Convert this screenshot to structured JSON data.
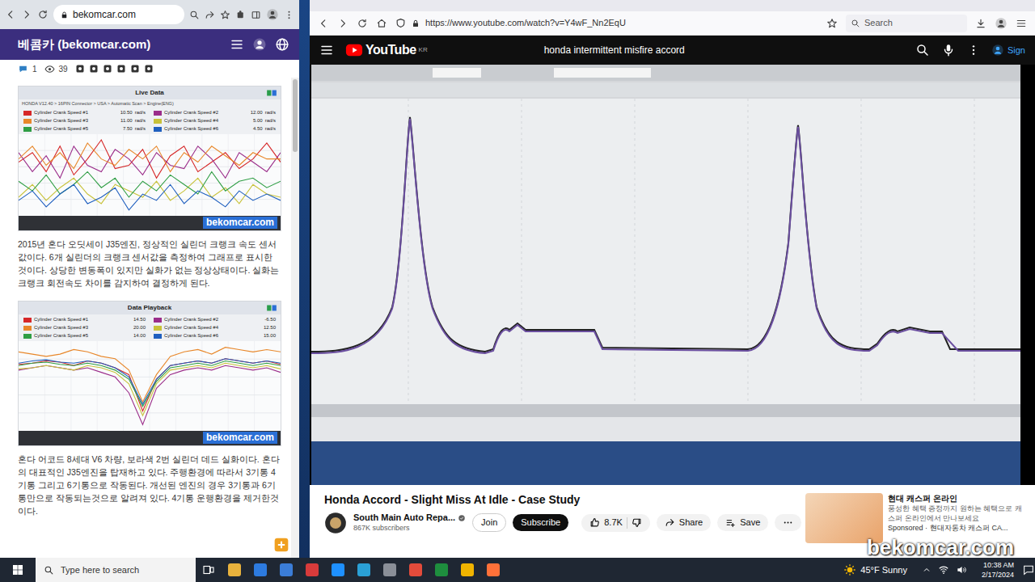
{
  "left_window": {
    "address": "bekomcar.com",
    "site_title": "베콤카 (bekomcar.com)",
    "comments": "1",
    "views": "39",
    "articles": [
      {
        "figure": {
          "title": "Live Data",
          "path": "HONDA V12.40 > 16PIN Connector > USA > Automatic Scan > Engine(ENG)",
          "watermark": "bekomcar.com",
          "series": [
            {
              "name": "Cylinder Crank Speed #1",
              "reading": "10.50",
              "unit": "rad/s",
              "color": "#d62728",
              "values": [
                10.5,
                12,
                9,
                13,
                8.5,
                11,
                14,
                9.5,
                10,
                12.5,
                8,
                11.5,
                13,
                9,
                10.5,
                12,
                9.5,
                11,
                13.5,
                10.5
              ]
            },
            {
              "name": "Cylinder Crank Speed #2",
              "reading": "12.00",
              "unit": "rad/s",
              "color": "#9b2d8a",
              "values": [
                12,
                9,
                11.5,
                8,
                13,
                10,
                9,
                12.5,
                11,
                8.5,
                12,
                10,
                9.5,
                13,
                11,
                8,
                12,
                10.5,
                9,
                12
              ]
            },
            {
              "name": "Cylinder Crank Speed #3",
              "reading": "11.00",
              "unit": "rad/s",
              "color": "#e8872a",
              "values": [
                11,
                13,
                10,
                12,
                9.5,
                13.5,
                11,
                10,
                12.5,
                11,
                13,
                9,
                12,
                10.5,
                13,
                11.5,
                10,
                12,
                11,
                11
              ]
            },
            {
              "name": "Cylinder Crank Speed #4",
              "reading": "5.00",
              "unit": "rad/s",
              "color": "#c8c23a",
              "values": [
                5,
                7,
                4.5,
                6.5,
                8,
                5.5,
                4,
                7,
                6,
                5,
                7.5,
                4.5,
                6,
                8,
                5,
                6.5,
                4,
                7,
                5.5,
                5
              ]
            },
            {
              "name": "Cylinder Crank Speed #5",
              "reading": "7.50",
              "unit": "rad/s",
              "color": "#2f9e44",
              "values": [
                7.5,
                6,
                8.5,
                5.5,
                7,
                9,
                6.5,
                8,
                5,
                7.5,
                6,
                8.5,
                7,
                5.5,
                9,
                6,
                7.5,
                8,
                6.5,
                7.5
              ]
            },
            {
              "name": "Cylinder Crank Speed #6",
              "reading": "4.50",
              "unit": "rad/s",
              "color": "#1f5fbf",
              "values": [
                4.5,
                6,
                3.5,
                5.5,
                7,
                4,
                5,
                6.5,
                3,
                5.5,
                4.5,
                7,
                4,
                6,
                5,
                3.5,
                6,
                4.5,
                5.5,
                4.5
              ]
            }
          ]
        },
        "text": "2015년 혼다 오딧세이 J35엔진, 정상적인 실린더 크랭크 속도 센서값이다. 6개 실린더의 크랭크 센서값을 측정하여 그래프로 표시한것이다. 상당한 변동폭이 있지만 실화가 없는 정상상태이다. 실화는 크랭크 회전속도 차이를 감지하여 결정하게 된다."
      },
      {
        "figure": {
          "title": "Data Playback",
          "watermark": "bekomcar.com",
          "series": [
            {
              "name": "Cylinder Crank Speed #1",
              "reading": "14.50",
              "color": "#d62728",
              "values": [
                14.5,
                15,
                16,
                15.5,
                14,
                16,
                15,
                13,
                10,
                -6,
                8,
                14,
                15,
                16,
                15,
                17,
                16,
                15,
                16,
                14.5
              ]
            },
            {
              "name": "Cylinder Crank Speed #2",
              "reading": "-6.50",
              "color": "#9b2d8a",
              "values": [
                12,
                13,
                14,
                13,
                12,
                13,
                11,
                9,
                2,
                -12,
                4,
                10,
                12,
                13,
                12,
                14,
                13,
                12,
                13,
                11
              ]
            },
            {
              "name": "Cylinder Crank Speed #3",
              "reading": "20.00",
              "color": "#e8872a",
              "values": [
                20,
                19,
                18,
                19,
                21,
                20,
                18,
                17,
                12,
                -2,
                10,
                18,
                20,
                21,
                19,
                22,
                21,
                20,
                21,
                20
              ]
            },
            {
              "name": "Cylinder Crank Speed #4",
              "reading": "12.50",
              "color": "#c8c23a",
              "values": [
                12.5,
                13,
                14,
                13,
                12,
                14,
                13,
                11,
                6,
                -8,
                6,
                12,
                13,
                14,
                13,
                15,
                14,
                13,
                14,
                12.5
              ]
            },
            {
              "name": "Cylinder Crank Speed #5",
              "reading": "14.00",
              "color": "#2f9e44",
              "values": [
                14,
                15,
                15.5,
                14.5,
                14,
                15,
                14,
                12,
                8,
                -4,
                7,
                13,
                14,
                15,
                14,
                16,
                15,
                14,
                15,
                14
              ]
            },
            {
              "name": "Cylinder Crank Speed #6",
              "reading": "15.00",
              "color": "#1f5fbf",
              "values": [
                15,
                16,
                16.5,
                15.5,
                15,
                16,
                15,
                13,
                9,
                -3,
                8,
                14,
                15,
                16,
                15,
                17,
                16,
                15,
                16,
                15
              ]
            }
          ]
        },
        "text": "혼다 어코드 8세대 V6 차량, 보라색 2번 실린더 데드 실화이다. 혼다의 대표적인 J35엔진을 탑재하고 있다. 주행환경에 따라서 3기통 4기통 그리고 6기통으로 작동된다. 개선된 엔진의 경우 3기통과 6기통만으로 작동되는것으로 알려져 있다. 4기통 운행환경을 제거한것이다."
      }
    ]
  },
  "right_window": {
    "address": "https://www.youtube.com/watch?v=Y4wF_Nn2EqU",
    "search_placeholder": "Search",
    "youtube": {
      "logo": "YouTube",
      "region": "KR",
      "query": "honda intermittent misfire accord",
      "sign_in": "Sign"
    },
    "video": {
      "title": "Honda Accord - Slight Miss At Idle - Case Study",
      "channel": "South Main Auto Repa...",
      "subscribers": "867K subscribers",
      "join": "Join",
      "subscribe": "Subscribe",
      "likes": "8.7K",
      "share": "Share",
      "save": "Save"
    },
    "ad": {
      "title": "현대 캐스퍼 온라인",
      "description": "풍성한 혜택 증정까지 원하는 혜택으로 캐스퍼 온라인에서 만나보세요",
      "sponsor": "Sponsored · 현대자동차 캐스퍼 CA..."
    }
  },
  "watermark": "bekomcar.com",
  "taskbar": {
    "search_placeholder": "Type here to search",
    "weather": "45°F Sunny",
    "time": "10:38 AM",
    "date": "2/17/2024"
  }
}
